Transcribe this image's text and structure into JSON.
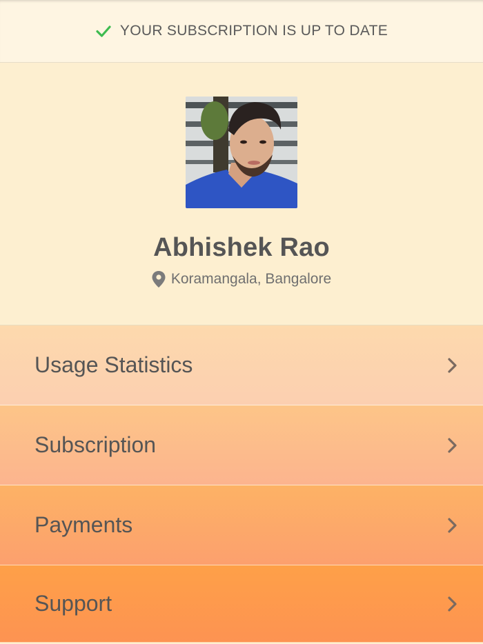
{
  "status": {
    "icon": "check-icon",
    "text": "YOUR SUBSCRIPTION IS UP TO DATE",
    "icon_color": "#3dbb4f"
  },
  "profile": {
    "name": "Abhishek Rao",
    "location_icon": "map-pin-icon",
    "location": "Koramangala, Bangalore"
  },
  "menu": {
    "items": [
      {
        "label": "Usage Statistics",
        "icon": "chevron-right-icon"
      },
      {
        "label": "Subscription",
        "icon": "chevron-right-icon"
      },
      {
        "label": "Payments",
        "icon": "chevron-right-icon"
      },
      {
        "label": "Support",
        "icon": "chevron-right-icon"
      }
    ]
  },
  "colors": {
    "profile_bg": "#fdefd0",
    "text": "#555555",
    "item_1": "#fdd4ae",
    "item_2": "#fcbc8b",
    "item_3": "#fca96a",
    "item_4": "#fd994d"
  }
}
